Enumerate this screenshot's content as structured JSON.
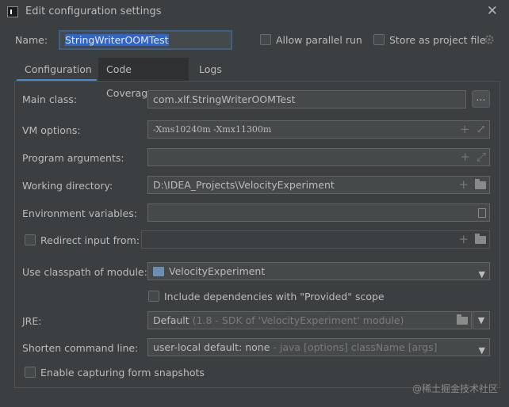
{
  "window": {
    "title": "Edit configuration settings",
    "close": "✕"
  },
  "header": {
    "name_label": "Name:",
    "name_value": "StringWriterOOMTest",
    "allow_parallel_label": "Allow parallel run",
    "allow_parallel_checked": false,
    "store_project_label": "Store as project file",
    "store_project_checked": false,
    "gear_icon": "gear-icon"
  },
  "tabs": [
    {
      "label": "Configuration",
      "active": true
    },
    {
      "label": "Code Coverage",
      "active": false
    },
    {
      "label": "Logs",
      "active": false
    }
  ],
  "form": {
    "main_class_label": "Main class:",
    "main_class_value": "com.xlf.StringWriterOOMTest",
    "browse_label": "...",
    "vm_options_label": "VM options:",
    "vm_options_value": "-Xms10240m -Xmx11300m",
    "program_args_label": "Program arguments:",
    "program_args_value": "",
    "working_dir_label": "Working directory:",
    "working_dir_value": "D:\\IDEA_Projects\\VelocityExperiment",
    "env_vars_label": "Environment variables:",
    "env_vars_value": "",
    "redirect_input_label": "Redirect input from:",
    "redirect_input_checked": false,
    "redirect_input_value": "",
    "classpath_label": "Use classpath of module:",
    "classpath_value": "VelocityExperiment",
    "include_deps_label": "Include dependencies with \"Provided\" scope",
    "include_deps_checked": false,
    "jre_label": "JRE:",
    "jre_value": "Default",
    "jre_detail": "(1.8 - SDK of 'VelocityExperiment' module)",
    "shorten_label": "Shorten command line:",
    "shorten_value": "user-local default: none",
    "shorten_detail": " - java [options] className [args]",
    "snapshots_label": "Enable capturing form snapshots",
    "snapshots_checked": false
  },
  "icons": {
    "plus": "+",
    "expand": "⤢",
    "dropdown": "▼"
  },
  "watermark": "@稀土掘金技术社区"
}
